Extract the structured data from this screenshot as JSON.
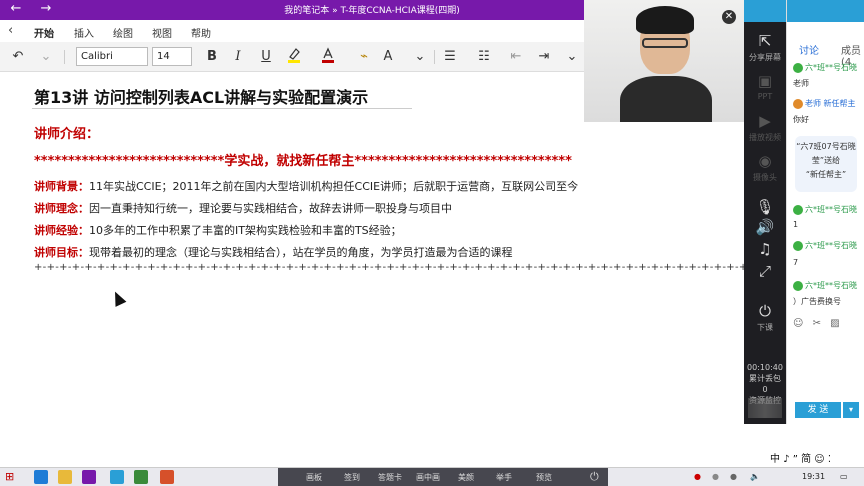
{
  "titlebar": {
    "back": "←",
    "forward": "→",
    "title": "我的笔记本 » T-年度CCNA-HCIA课程(四期)",
    "minimize": "—",
    "maximize": "□"
  },
  "ribbon": {
    "back": "‹",
    "tabs": [
      "开始",
      "插入",
      "绘图",
      "视图",
      "帮助"
    ],
    "font_name": "Calibri",
    "font_size": "14",
    "bold": "B",
    "italic": "I",
    "underline": "U",
    "more": "⌄"
  },
  "note": {
    "heading": "第13讲  访问控制列表ACL讲解与实验配置演示",
    "intro_label": "讲师介绍：",
    "banner": "****************************学实战，就找新任帮主********************************",
    "rows": [
      {
        "label": "讲师背景：",
        "text": "11年实战CCIE；2011年之前在国内大型培训机构担任CCIE讲师；后就职于运营商，互联网公司至今"
      },
      {
        "label": "讲师理念：",
        "text": "因一直秉持知行统一，理论要与实践相结合，故辞去讲师一职投身与项目中"
      },
      {
        "label": "讲师经验：",
        "text": "10多年的工作中积累了丰富的IT架构实践检验和丰富的TS经验；"
      },
      {
        "label": "讲师目标：",
        "text": "现带着最初的理念（理论与实践相结合），站在学员的角度，为学员打造最为合适的课程"
      }
    ],
    "dashes": "+-+-+-+-+-+-+-+-+-+-+-+-+-+-+-+-+-+-+-+-+-+-+-+-+-+-+-+-+-+-+-+-+-+-+-+-+-+-+-+-+-+-+-+-+-+-+-+-+-+-+-+-+-+-+-+-+-+-+-"
  },
  "webcam": {
    "close": "✕"
  },
  "toolcol": {
    "items": [
      {
        "label": "分享屏幕",
        "icon": "share-screen-icon"
      },
      {
        "label": "PPT",
        "icon": "ppt-icon"
      },
      {
        "label": "播放视频",
        "icon": "video-icon"
      },
      {
        "label": "摄像头",
        "icon": "camera-icon"
      },
      {
        "label": "下课",
        "icon": "end-class-icon"
      }
    ],
    "timer": "00:10:40",
    "stat1": "累计丢包",
    "stat2": "0",
    "stat3": "资源监控"
  },
  "chat": {
    "tab_discuss": "讨论",
    "tab_members": "成员(4",
    "messages": [
      {
        "name": "六*班**号石晓",
        "text": "老师"
      },
      {
        "name": "老师  新任帮主",
        "text": "你好"
      }
    ],
    "gift_lines": [
      "“六7班07号石晓",
      "莹”送给",
      "“新任帮主”"
    ],
    "messages2": [
      {
        "name": "六*班**号石晓",
        "text": "1"
      },
      {
        "name": "六*班**号石晓",
        "text": "7"
      },
      {
        "name": "六*班**号石晓",
        "text": "）广告费换号"
      }
    ],
    "send": "发 送"
  },
  "taskbar": {
    "tools": [
      "画板",
      "签到",
      "答题卡",
      "画中画",
      "美颜",
      "举手",
      "预览"
    ],
    "time": "19:31",
    "ime": "中 ♪ ” 简 ☺ ⁚"
  },
  "colors": {
    "onenote_purple": "#7719aa",
    "accent_blue": "#2a9fd6",
    "heading_red": "#c00000"
  }
}
